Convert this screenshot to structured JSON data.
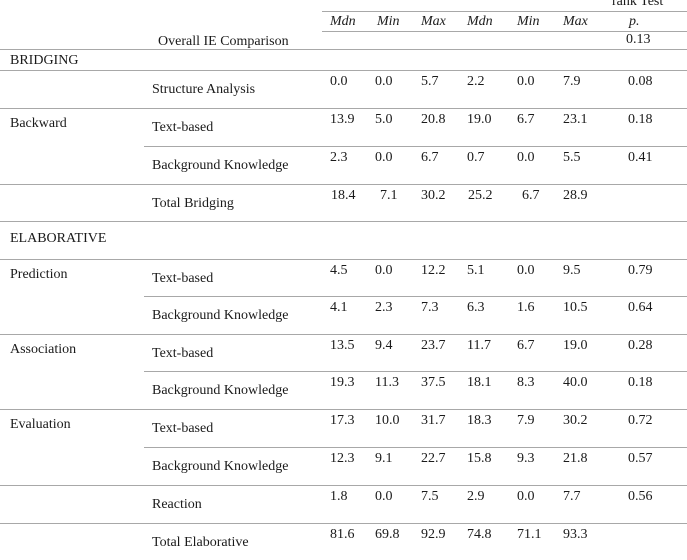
{
  "header": {
    "test_label": "rank Test",
    "columns": [
      "Mdn",
      "Min",
      "Max",
      "Mdn",
      "Min",
      "Max",
      "p."
    ],
    "overall_label": "Overall IE Comparison",
    "overall_p": "0.13"
  },
  "sections": {
    "bridging": "BRIDGING",
    "elaborative": "ELABORATIVE"
  },
  "rows": [
    {
      "group": "",
      "category": "Structure Analysis",
      "values": [
        "0.0",
        "0.0",
        "5.7",
        "2.2",
        "0.0",
        "7.9"
      ],
      "p": "0.08"
    },
    {
      "group": "Backward",
      "category": "Text-based",
      "values": [
        "13.9",
        "5.0",
        "20.8",
        "19.0",
        "6.7",
        "23.1"
      ],
      "p": "0.18"
    },
    {
      "group": "",
      "category": "Background Knowledge",
      "values": [
        "2.3",
        "0.0",
        "6.7",
        "0.7",
        "0.0",
        "5.5"
      ],
      "p": "0.41"
    },
    {
      "group": "",
      "category": "Total Bridging",
      "values": [
        "18.4",
        "7.1",
        "30.2",
        "25.2",
        "6.7",
        "28.9"
      ],
      "p": ""
    },
    {
      "group": "Prediction",
      "category": "Text-based",
      "values": [
        "4.5",
        "0.0",
        "12.2",
        "5.1",
        "0.0",
        "9.5"
      ],
      "p": "0.79"
    },
    {
      "group": "",
      "category": "Background Knowledge",
      "values": [
        "4.1",
        "2.3",
        "7.3",
        "6.3",
        "1.6",
        "10.5"
      ],
      "p": "0.64"
    },
    {
      "group": "Association",
      "category": "Text-based",
      "values": [
        "13.5",
        "9.4",
        "23.7",
        "11.7",
        "6.7",
        "19.0"
      ],
      "p": "0.28"
    },
    {
      "group": "",
      "category": "Background Knowledge",
      "values": [
        "19.3",
        "11.3",
        "37.5",
        "18.1",
        "8.3",
        "40.0"
      ],
      "p": "0.18"
    },
    {
      "group": "Evaluation",
      "category": "Text-based",
      "values": [
        "17.3",
        "10.0",
        "31.7",
        "18.3",
        "7.9",
        "30.2"
      ],
      "p": "0.72"
    },
    {
      "group": "",
      "category": "Background Knowledge",
      "values": [
        "12.3",
        "9.1",
        "22.7",
        "15.8",
        "9.3",
        "21.8"
      ],
      "p": "0.57"
    },
    {
      "group": "",
      "category": "Reaction",
      "values": [
        "1.8",
        "0.0",
        "7.5",
        "2.9",
        "0.0",
        "7.7"
      ],
      "p": "0.56"
    },
    {
      "group": "",
      "category": "Total Elaborative",
      "values": [
        "81.6",
        "69.8",
        "92.9",
        "74.8",
        "71.1",
        "93.3"
      ],
      "p": ""
    }
  ]
}
